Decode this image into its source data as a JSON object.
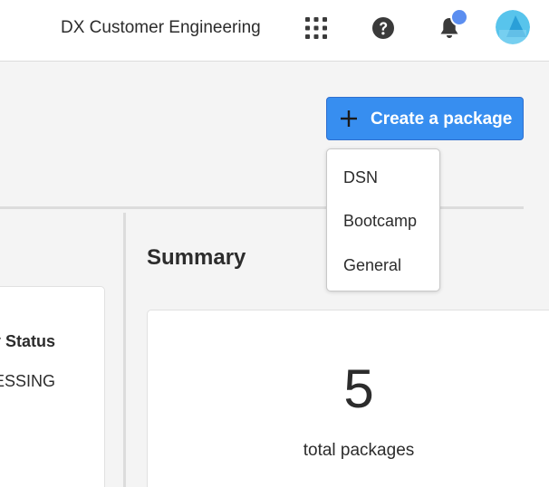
{
  "header": {
    "org_name": "DX Customer Engineering",
    "icons": {
      "apps": "apps-grid-icon",
      "help": "help-icon",
      "notifications": "bell-icon",
      "avatar": "user-avatar"
    },
    "notification_dot_color": "#5b8ef0"
  },
  "actions": {
    "create_label": "Create a package",
    "create_icon": "plus-icon",
    "accent_color": "#378ef0"
  },
  "create_menu": {
    "items": [
      "DSN",
      "Bootcamp",
      "General"
    ]
  },
  "packages_table": {
    "status_header": "y Status",
    "status_value": "ESSING"
  },
  "summary": {
    "title": "Summary",
    "count": "5",
    "caption": "total packages"
  }
}
